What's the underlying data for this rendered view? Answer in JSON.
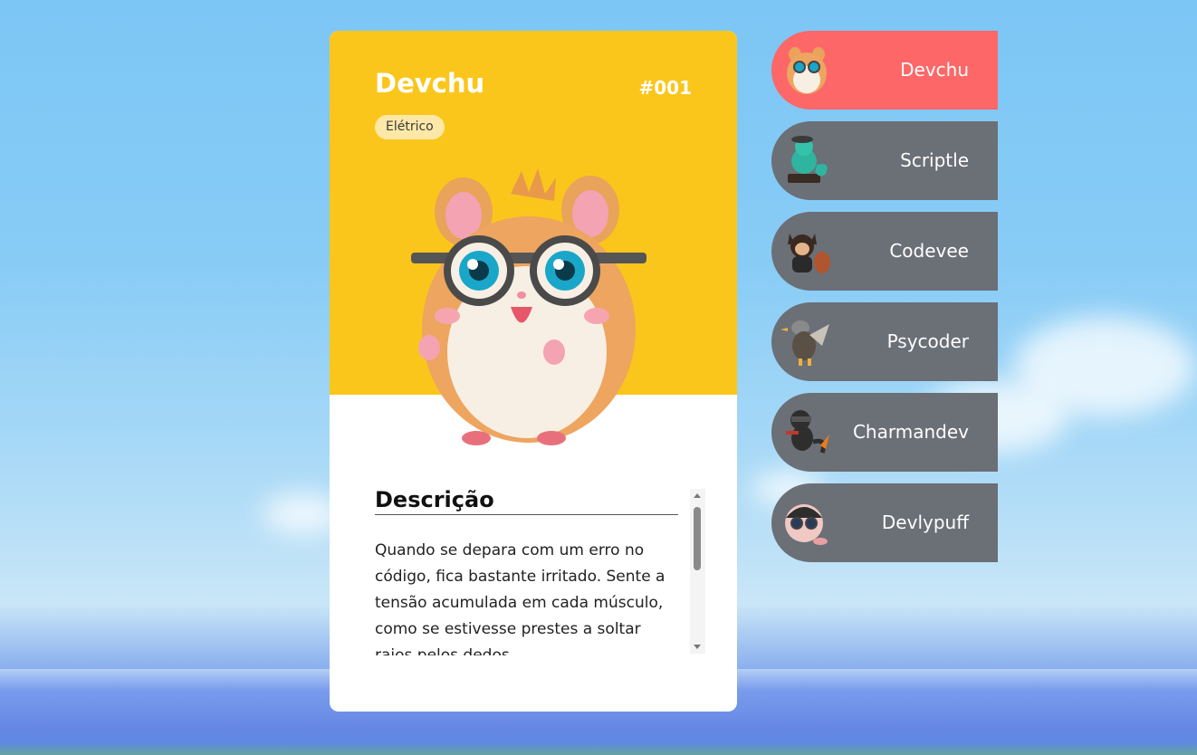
{
  "colors": {
    "card_top": "#fbc61b",
    "active_item": "#fd6767",
    "inactive_item": "#6b6f76"
  },
  "pokemon": {
    "name": "Devchu",
    "number": "#001",
    "type": "Elétrico",
    "image_icon": "hamster-with-glasses",
    "description_title": "Descrição",
    "description_text": "Quando se depara com um erro no código, fica bastante irritado. Sente a tensão acumulada em cada músculo, como se estivesse prestes a soltar raios pelos dedos."
  },
  "roster": [
    {
      "label": "Devchu",
      "icon": "hamster-icon",
      "active": true
    },
    {
      "label": "Scriptle",
      "icon": "turtle-icon",
      "active": false
    },
    {
      "label": "Codevee",
      "icon": "fox-icon",
      "active": false
    },
    {
      "label": "Psycoder",
      "icon": "duck-icon",
      "active": false
    },
    {
      "label": "Charmandev",
      "icon": "lizard-icon",
      "active": false
    },
    {
      "label": "Devlypuff",
      "icon": "puff-icon",
      "active": false
    }
  ]
}
